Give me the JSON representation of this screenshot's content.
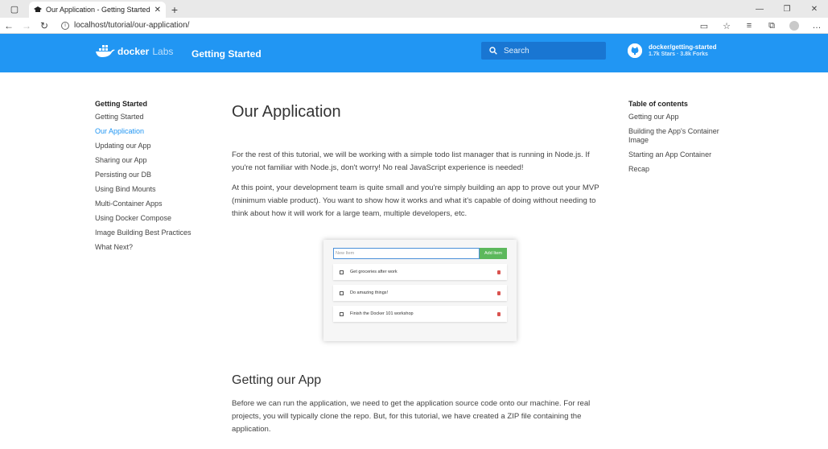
{
  "browser": {
    "tab_title": "Our Application - Getting Started",
    "url": "localhost/tutorial/our-application/"
  },
  "header": {
    "logo_text": "docker",
    "logo_labs": "Labs",
    "site_title": "Getting Started",
    "search_placeholder": "Search",
    "repo_name": "docker/getting-started",
    "repo_stats": "1.7k Stars · 3.8k Forks",
    "brand_color": "#2196f3"
  },
  "left_nav": {
    "heading": "Getting Started",
    "items": [
      {
        "label": "Getting Started"
      },
      {
        "label": "Our Application"
      },
      {
        "label": "Updating our App"
      },
      {
        "label": "Sharing our App"
      },
      {
        "label": "Persisting our DB"
      },
      {
        "label": "Using Bind Mounts"
      },
      {
        "label": "Multi-Container Apps"
      },
      {
        "label": "Using Docker Compose"
      },
      {
        "label": "Image Building Best Practices"
      },
      {
        "label": "What Next?"
      }
    ],
    "active_index": 1
  },
  "main": {
    "title": "Our Application",
    "para1": "For the rest of this tutorial, we will be working with a simple todo list manager that is running in Node.js. If you're not familiar with Node.js, don't worry! No real JavaScript experience is needed!",
    "para2": "At this point, your development team is quite small and you're simply building an app to prove out your MVP (minimum viable product). You want to show how it works and what it's capable of doing without needing to think about how it will work for a large team, multiple developers, etc.",
    "screenshot": {
      "input_placeholder": "New Item",
      "add_label": "Add Item",
      "items": [
        {
          "text": "Get groceries after work"
        },
        {
          "text": "Do amazing things!"
        },
        {
          "text": "Finish the Docker 101 workshop"
        }
      ]
    },
    "section_title": "Getting our App",
    "para3": "Before we can run the application, we need to get the application source code onto our machine. For real projects, you will typically clone the repo. But, for this tutorial, we have created a ZIP file containing the application."
  },
  "toc": {
    "heading": "Table of contents",
    "items": [
      {
        "label": "Getting our App"
      },
      {
        "label": "Building the App's Container Image"
      },
      {
        "label": "Starting an App Container"
      },
      {
        "label": "Recap"
      }
    ]
  }
}
